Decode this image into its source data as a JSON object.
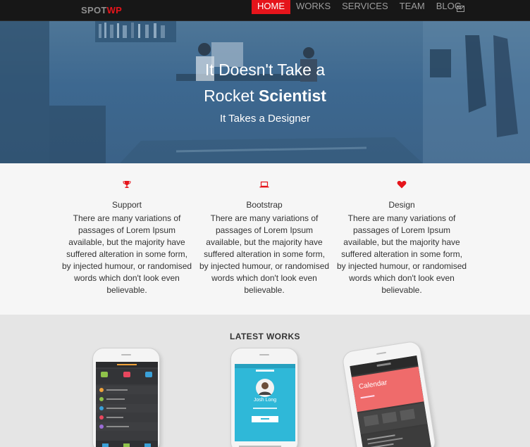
{
  "brand": {
    "part1": "SPOT",
    "part2": "WP"
  },
  "nav": {
    "items": [
      {
        "label": "HOME",
        "active": true
      },
      {
        "label": "WORKS",
        "active": false
      },
      {
        "label": "SERVICES",
        "active": false
      },
      {
        "label": "TEAM",
        "active": false
      },
      {
        "label": "BLOG",
        "active": false
      }
    ],
    "mail_icon": "envelope-icon"
  },
  "hero": {
    "line1": "It Doesn't Take a",
    "line2_regular": "Rocket ",
    "line2_bold": "Scientist",
    "subtitle": "It Takes a Designer"
  },
  "features": [
    {
      "icon": "trophy-icon",
      "title": "Support",
      "text": "There are many variations of passages of Lorem Ipsum available, but the majority have suffered alteration in some form, by injected humour, or randomised words which don't look even believable."
    },
    {
      "icon": "laptop-icon",
      "title": "Bootstrap",
      "text": "There are many variations of passages of Lorem Ipsum available, but the majority have suffered alteration in some form, by injected humour, or randomised words which don't look even believable."
    },
    {
      "icon": "heart-icon",
      "title": "Design",
      "text": "There are many variations of passages of Lorem Ipsum available, but the majority have suffered alteration in some form, by injected humour, or randomised words which don't look even believable."
    }
  ],
  "works": {
    "title": "LATEST WORKS",
    "phone2_name": "Josh Long",
    "phone3_label": "Calendar"
  },
  "colors": {
    "accent": "#e5141b",
    "navbar": "#171717",
    "hero_overlay": "#3d6890"
  }
}
